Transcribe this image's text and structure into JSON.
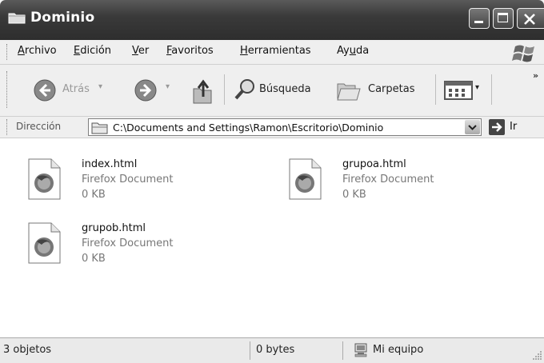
{
  "window": {
    "title": "Dominio"
  },
  "menu": [
    {
      "label": "Archivo",
      "accel_index": 0
    },
    {
      "label": "Edición",
      "accel_index": 0
    },
    {
      "label": "Ver",
      "accel_index": 0
    },
    {
      "label": "Favoritos",
      "accel_index": 0
    },
    {
      "label": "Herramientas",
      "accel_index": 0
    },
    {
      "label": "Ayuda",
      "accel_index": 2
    }
  ],
  "toolbar": {
    "back_label": "Atrás",
    "search_label": "Búsqueda",
    "folders_label": "Carpetas",
    "more_glyph": "»"
  },
  "address": {
    "label": "Dirección",
    "path": "C:\\Documents and Settings\\Ramon\\Escritorio\\Dominio",
    "go_label": "Ir"
  },
  "files": [
    {
      "name": "index.html",
      "type": "Firefox Document",
      "size": "0 KB"
    },
    {
      "name": "grupoa.html",
      "type": "Firefox Document",
      "size": "0 KB"
    },
    {
      "name": "grupob.html",
      "type": "Firefox Document",
      "size": "0 KB"
    }
  ],
  "status": {
    "count": "3 objetos",
    "bytes": "0 bytes",
    "location": "Mi equipo"
  }
}
